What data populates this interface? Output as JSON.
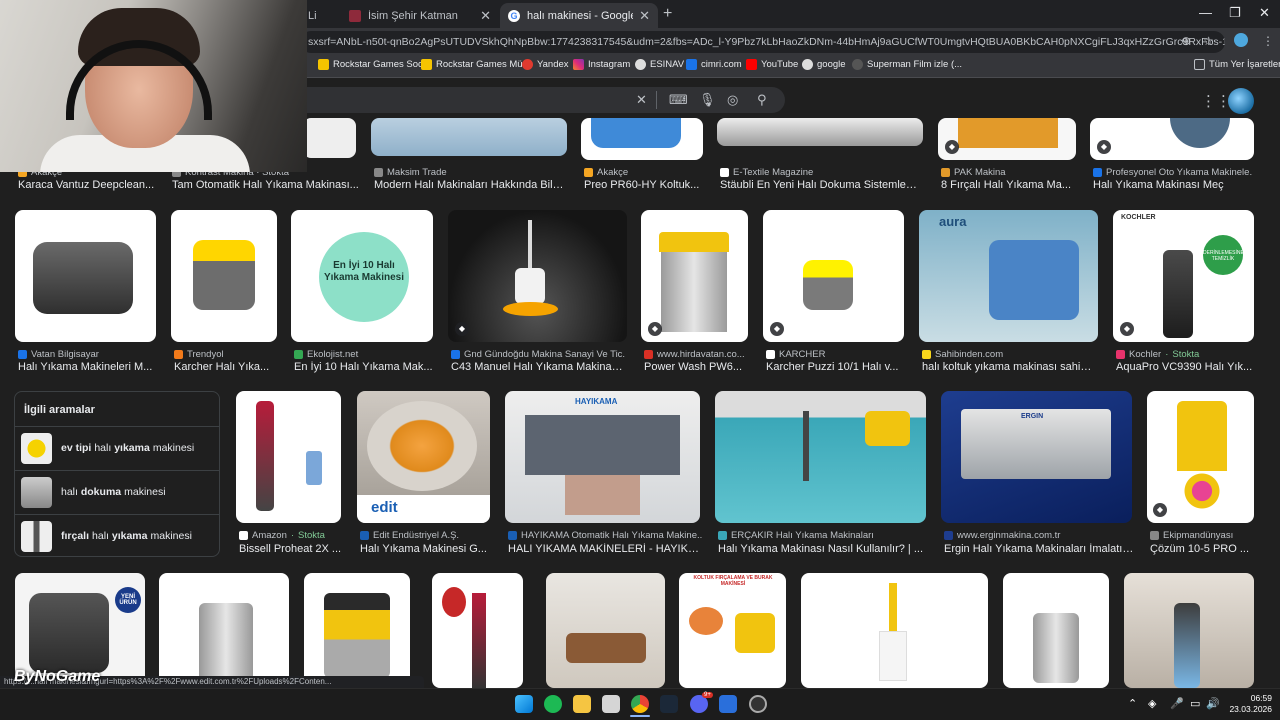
{
  "browser": {
    "tabs": [
      {
        "title": "Li",
        "active": false
      },
      {
        "title": "İsim Şehir Katman",
        "active": false
      },
      {
        "title": "halı makinesi - Google'da Ara",
        "active": true
      }
    ],
    "url": "sxsrf=ANbL-n50t-qnBo2AgPsUTUDVSkhQhNpBbw:1774238317545&udm=2&fbs=ADc_l-Y9Pbz7kLbHaoZkDNm-44bHmAj9aGUCfWT0UmgtvHQtBUA0BKbCAH0pNXCgiFLJ3qxHZzGrGrc9RxFbs-1u5Ar4PLZ3C5Z...",
    "bookmarks": [
      "Rockstar Games Soc...",
      "Rockstar Games Mü...",
      "Yandex",
      "Instagram",
      "ESINAV",
      "cimri.com",
      "YouTube",
      "google",
      "Superman Film izle (..."
    ],
    "all_bookmarks": "Tüm Yer İşaretleri"
  },
  "results": {
    "row1": [
      {
        "source": "Akakçe",
        "title": "Karaca Vantuz Deepclean..."
      },
      {
        "source": "Kontrast Makina · Stokta",
        "title": "Tam Otomatik Halı Yıkama Makinası..."
      },
      {
        "source": "Maksim Trade",
        "title": "Modern Halı Makinaları Hakkında Bili..."
      },
      {
        "source": "Akakçe",
        "title": "Preo PR60-HY Koltuk..."
      },
      {
        "source": "E-Textile Magazine",
        "title": "Stäubli En Yeni Halı Dokuma Sistemleri i..."
      },
      {
        "source": "PAK Makina",
        "title": "8 Fırçalı Halı Yıkama Ma..."
      },
      {
        "source": "Profesyonel Oto Yıkama Makinele...",
        "title": "Halı Yıkama Makinası Meç"
      }
    ],
    "row2": [
      {
        "source": "Vatan Bilgisayar",
        "title": "Halı Yıkama Makineleri M..."
      },
      {
        "source": "Trendyol",
        "title": "Karcher Halı Yıka..."
      },
      {
        "source": "Ekolojist.net",
        "title": "En İyi 10 Halı Yıkama Mak..."
      },
      {
        "source": "Gnd Gündoğdu Makina Sanayi Ve Tic...",
        "title": "C43 Manuel Halı Yıkama Makinası..."
      },
      {
        "source": "www.hirdavatan.co...",
        "title": "Power Wash PW6..."
      },
      {
        "source": "KARCHER",
        "title": "Karcher Puzzi 10/1 Halı v..."
      },
      {
        "source": "Sahibinden.com",
        "title": "halı koltuk yıkama makinası sahibi..."
      },
      {
        "source": "Kochler",
        "stock": "Stokta",
        "title": "AquaPro VC9390 Halı Yık..."
      }
    ],
    "row3": [
      {
        "source": "Amazon",
        "stock": "Stokta",
        "title": "Bissell Proheat 2X ..."
      },
      {
        "source": "Edit Endüstriyel A.Ş.",
        "title": "Halı Yıkama Makinesi G..."
      },
      {
        "source": "HAYIKAMA Otomatik Halı Yıkama Makine...",
        "title": "HALI YIKAMA MAKİNELERİ - HAYIKA..."
      },
      {
        "source": "ERÇAKIR Halı Yıkama Makinaları",
        "title": "Halı Yıkama Makinası Nasıl Kullanılır? | ..."
      },
      {
        "source": "www.erginmakina.com.tr",
        "title": "Ergin Halı Yıkama Makinaları İmalatı ..."
      },
      {
        "source": "Ekipmandünyası",
        "title": "Çözüm 10-5 PRO ..."
      }
    ]
  },
  "image_text": {
    "ekolojist": "En İyi 10 Halı Yıkama Makinesi",
    "edit_logo": "edit",
    "hayikama_logo": "HAYIKAMA",
    "ergin_logo": "ERGIN",
    "aura_logo": "aura",
    "kochler_logo": "KOCHLER",
    "kochler_badge": "DERİNLEMESİNE TEMİZLİK",
    "new_badge": "YENİ ÜRÜN",
    "koltuk_label": "KOLTUK FIRÇALAMA VE BURAK MAKİNESİ"
  },
  "related": {
    "title": "İlgili aramalar",
    "items": [
      {
        "bold": "ev tipi",
        "rest": "halı",
        "bold2": "yıkama",
        "rest2": "makinesi"
      },
      {
        "bold": "",
        "rest": "halı",
        "bold2": "dokuma",
        "rest2": "makinesi"
      },
      {
        "bold": "fırçalı",
        "rest": "halı",
        "bold2": "yıkama",
        "rest2": "makinesi"
      }
    ]
  },
  "status_url": "https://...halı makinesi&imgurl=https%3A%2F%2Fwww.edit.com.tr%2FUploads%2FConten...",
  "watermark": "ByNoGame",
  "taskbar": {
    "time": "06:59",
    "date": "23.03.2026",
    "badge": "9+"
  }
}
